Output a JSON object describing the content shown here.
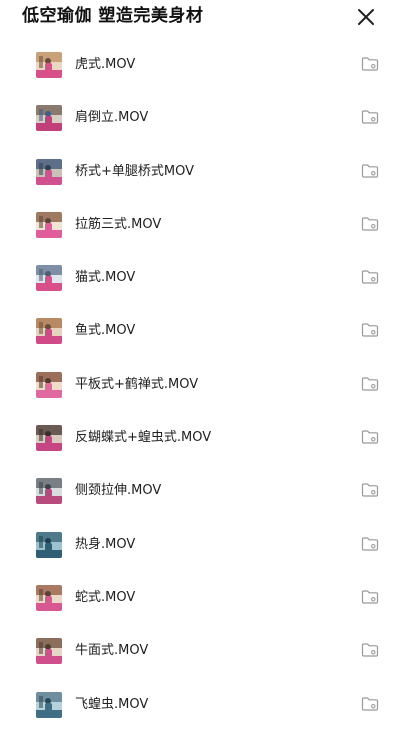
{
  "header": {
    "title": "低空瑜伽 塑造完美身材"
  },
  "files": [
    {
      "name": "虎式.MOV"
    },
    {
      "name": "肩倒立.MOV"
    },
    {
      "name": "桥式+单腿桥式MOV"
    },
    {
      "name": "拉筋三式.MOV"
    },
    {
      "name": "猫式.MOV"
    },
    {
      "name": "鱼式.MOV"
    },
    {
      "name": "平板式+鹤禅式.MOV"
    },
    {
      "name": "反蝴蝶式+蝗虫式.MOV"
    },
    {
      "name": "侧颈拉伸.MOV"
    },
    {
      "name": "热身.MOV"
    },
    {
      "name": "蛇式.MOV"
    },
    {
      "name": "牛面式.MOV"
    },
    {
      "name": "飞蝗虫.MOV"
    }
  ],
  "icons": {
    "close": "close-icon",
    "thumbnail": "video-thumbnail",
    "folder": "folder-icon"
  },
  "colors": {
    "text": "#1f1f1f",
    "icon": "#9a9a9a",
    "background": "#ffffff"
  }
}
